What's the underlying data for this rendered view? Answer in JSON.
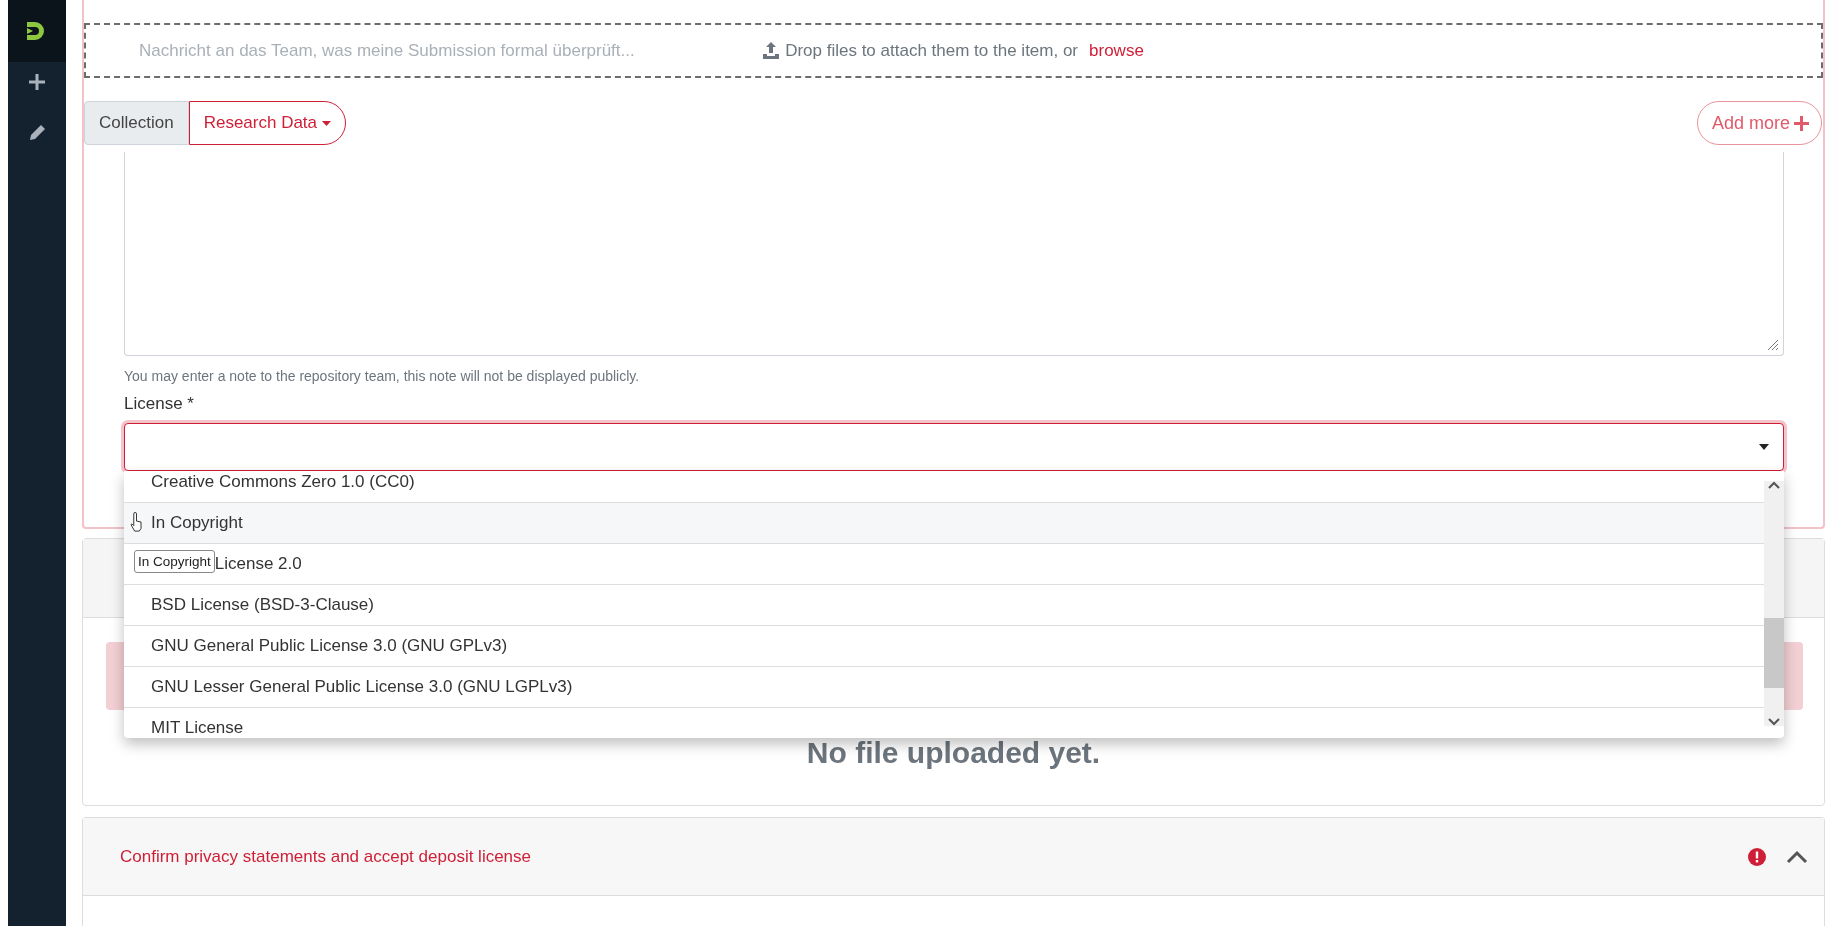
{
  "message_field": {
    "placeholder": "Nachricht an das Team, was meine Submission formal überprüft..."
  },
  "dropzone": {
    "text": "Drop files to attach them to the item, or",
    "link": "browse"
  },
  "collection": {
    "label": "Collection",
    "value": "Research Data"
  },
  "add_more": "Add more",
  "note_hint": "You may enter a note to the repository team, this note will not be displayed publicly.",
  "license": {
    "label": "License *",
    "invalid": true,
    "options": [
      {
        "label": "Creative Commons Zero 1.0 (CC0)",
        "highlighted": false
      },
      {
        "label": "In Copyright",
        "highlighted": true
      },
      {
        "label": "License 2.0",
        "highlighted": false
      },
      {
        "label": "BSD License (BSD-3-Clause)",
        "highlighted": false
      },
      {
        "label": "GNU General Public License 3.0 (GNU GPLv3)",
        "highlighted": false
      },
      {
        "label": "GNU Lesser General Public License 3.0 (GNU LGPLv3)",
        "highlighted": false
      },
      {
        "label": "MIT License",
        "highlighted": false
      }
    ],
    "tooltip": "In Copyright"
  },
  "upload_panel": {
    "message": "No file uploaded yet."
  },
  "sections": [
    {
      "title": "Confirm privacy statements and accept deposit license",
      "error": true,
      "expanded": true
    }
  ]
}
